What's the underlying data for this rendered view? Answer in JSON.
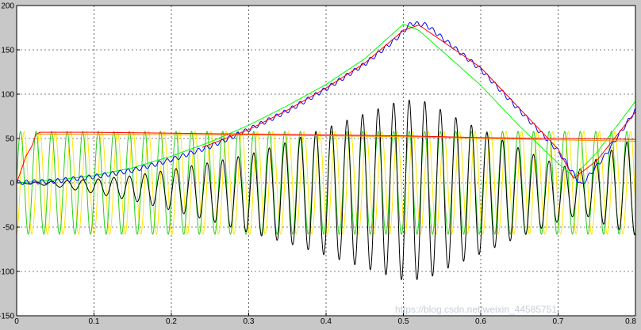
{
  "chart_data": {
    "type": "line",
    "title": "",
    "xlabel": "",
    "ylabel": "",
    "xlim": [
      0,
      0.8
    ],
    "ylim": [
      -150,
      200
    ],
    "grid": true,
    "legend": "none",
    "x_ticks": [
      {
        "value": 0,
        "label": "0"
      },
      {
        "value": 0.1,
        "label": "0.1"
      },
      {
        "value": 0.2,
        "label": "0.2"
      },
      {
        "value": 0.3,
        "label": "0.3"
      },
      {
        "value": 0.4,
        "label": "0.4"
      },
      {
        "value": 0.5,
        "label": "0.5"
      },
      {
        "value": 0.6,
        "label": "0.6"
      },
      {
        "value": 0.7,
        "label": "0.7"
      },
      {
        "value": 0.8,
        "label": "0.8"
      }
    ],
    "y_ticks": [
      {
        "value": 200,
        "label": "200"
      },
      {
        "value": 150,
        "label": "150"
      },
      {
        "value": 100,
        "label": "100"
      },
      {
        "value": 50,
        "label": "50"
      },
      {
        "value": 0,
        "label": "0"
      },
      {
        "value": -50,
        "label": "-50"
      },
      {
        "value": -100,
        "label": "-100"
      },
      {
        "value": -150,
        "label": "-150"
      }
    ],
    "colors": {
      "background": "#c8c8c8",
      "plot_area": "#ffffff",
      "grid": "#000000"
    },
    "series": [
      {
        "color": "#ffe800",
        "kind": "sine",
        "amplitude": 58,
        "offset": 0,
        "period": 0.0201,
        "phase": 0.0047,
        "t_start": 0,
        "t_end": 0.8
      },
      {
        "color": "#29cf1d",
        "kind": "sine",
        "amplitude": 58,
        "offset": 0,
        "period": 0.0201,
        "phase": 0,
        "t_start": 0,
        "t_end": 0.8
      },
      {
        "color": "#000000",
        "kind": "modulated_sine",
        "period": 0.0201,
        "amplitude_envelope": [
          [
            0,
            0
          ],
          [
            0.05,
            3
          ],
          [
            0.1,
            8
          ],
          [
            0.15,
            14
          ],
          [
            0.2,
            23
          ],
          [
            0.25,
            33
          ],
          [
            0.3,
            44
          ],
          [
            0.35,
            57
          ],
          [
            0.4,
            72
          ],
          [
            0.45,
            87
          ],
          [
            0.5,
            102
          ],
          [
            0.53,
            100
          ],
          [
            0.56,
            86
          ],
          [
            0.6,
            70
          ],
          [
            0.65,
            50
          ],
          [
            0.7,
            32
          ],
          [
            0.73,
            25
          ],
          [
            0.76,
            40
          ],
          [
            0.8,
            55
          ]
        ],
        "offset_envelope": [
          [
            0,
            0
          ],
          [
            0.05,
            -1
          ],
          [
            0.1,
            -4
          ],
          [
            0.2,
            -8
          ],
          [
            0.3,
            -12
          ],
          [
            0.5,
            -8
          ],
          [
            0.6,
            -10
          ],
          [
            0.7,
            -12
          ],
          [
            0.8,
            -4
          ]
        ],
        "t_start": 0,
        "t_end": 0.8
      },
      {
        "color": "#00ff00",
        "kind": "polyline",
        "points": [
          [
            0,
            0
          ],
          [
            0.05,
            3
          ],
          [
            0.1,
            8
          ],
          [
            0.15,
            17
          ],
          [
            0.2,
            30
          ],
          [
            0.25,
            46
          ],
          [
            0.3,
            65
          ],
          [
            0.35,
            87
          ],
          [
            0.4,
            111
          ],
          [
            0.45,
            140
          ],
          [
            0.5,
            179
          ],
          [
            0.52,
            172
          ],
          [
            0.6,
            110
          ],
          [
            0.65,
            64
          ],
          [
            0.7,
            22
          ],
          [
            0.72,
            7
          ],
          [
            0.75,
            34
          ],
          [
            0.8,
            92
          ]
        ]
      },
      {
        "color": "#0000ff",
        "kind": "polyline",
        "wobble": 2.5,
        "points": [
          [
            0,
            0
          ],
          [
            0.05,
            2
          ],
          [
            0.1,
            7
          ],
          [
            0.15,
            14
          ],
          [
            0.2,
            26
          ],
          [
            0.25,
            41
          ],
          [
            0.3,
            60
          ],
          [
            0.35,
            81
          ],
          [
            0.4,
            106
          ],
          [
            0.45,
            134
          ],
          [
            0.49,
            162
          ],
          [
            0.51,
            180
          ],
          [
            0.53,
            178
          ],
          [
            0.6,
            128
          ],
          [
            0.65,
            82
          ],
          [
            0.7,
            36
          ],
          [
            0.73,
            -3
          ],
          [
            0.76,
            30
          ],
          [
            0.8,
            82
          ]
        ]
      },
      {
        "color": "#ff0000",
        "kind": "polyline",
        "points": [
          [
            0,
            0
          ],
          [
            0.005,
            12
          ],
          [
            0.012,
            30
          ],
          [
            0.02,
            42
          ],
          [
            0.025,
            55
          ],
          [
            0.03,
            57
          ],
          [
            0.1,
            57
          ],
          [
            0.2,
            56
          ],
          [
            0.3,
            55
          ],
          [
            0.4,
            54
          ],
          [
            0.5,
            53
          ],
          [
            0.6,
            51
          ],
          [
            0.7,
            50
          ],
          [
            0.8,
            49
          ]
        ],
        "second_segment": [
          [
            0.24,
            40
          ],
          [
            0.3,
            60
          ],
          [
            0.35,
            82
          ],
          [
            0.4,
            107
          ],
          [
            0.45,
            135
          ],
          [
            0.5,
            172
          ],
          [
            0.52,
            178
          ],
          [
            0.6,
            130
          ],
          [
            0.65,
            84
          ],
          [
            0.7,
            38
          ],
          [
            0.72,
            5
          ],
          [
            0.75,
            25
          ],
          [
            0.8,
            80
          ]
        ]
      },
      {
        "color": "#ff8c00",
        "kind": "polyline",
        "points": [
          [
            0.025,
            55
          ],
          [
            0.3,
            54
          ],
          [
            0.5,
            52
          ],
          [
            0.6,
            50
          ],
          [
            0.8,
            47
          ]
        ]
      }
    ]
  },
  "watermark": "https://blog.csdn.net/weixin_44585751"
}
